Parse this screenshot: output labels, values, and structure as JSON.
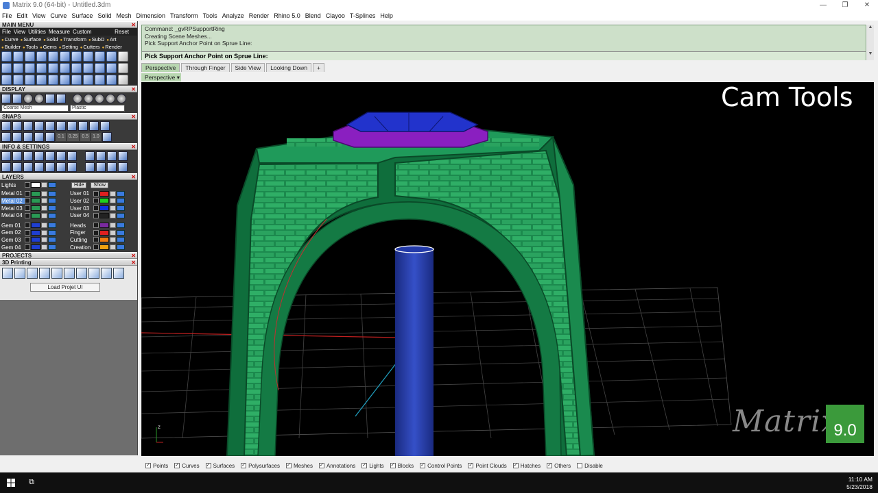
{
  "window": {
    "title": "Matrix 9.0 (64-bit) - Untitled.3dm",
    "controls": [
      "minimize-icon",
      "restore-icon",
      "close-icon"
    ]
  },
  "menubar": [
    "File",
    "Edit",
    "View",
    "Curve",
    "Surface",
    "Solid",
    "Mesh",
    "Dimension",
    "Transform",
    "Tools",
    "Analyze",
    "Render",
    "Rhino 5.0",
    "Blend",
    "Clayoo",
    "T-Splines",
    "Help"
  ],
  "leftpanel": {
    "main_menu": {
      "header": "MAIN MENU",
      "items": [
        "File",
        "View",
        "Utilities",
        "Measure",
        "Custom"
      ],
      "reset": "Reset",
      "categories_row1": [
        "Curve",
        "Surface",
        "Solid",
        "Transform",
        "SubD",
        "Art"
      ],
      "categories_row2": [
        "Builder",
        "Tools",
        "Gems",
        "Setting",
        "Cutters",
        "Render"
      ]
    },
    "display": {
      "header": "DISPLAY",
      "mesh_combo": "Coarse Mesh",
      "material_combo": "Plastic"
    },
    "snaps": {
      "header": "SNAPS",
      "values": [
        "0.1",
        "0.25",
        "0.5",
        "1.0"
      ]
    },
    "info": {
      "header": "INFO & SETTINGS"
    },
    "layers": {
      "header": "LAYERS",
      "lights_label": "Lights",
      "hide_label": "Hide",
      "show_label": "Show",
      "left": [
        {
          "name": "Metal 01",
          "color": "#2a9a55"
        },
        {
          "name": "Metal 02",
          "color": "#2a9a55",
          "selected": true
        },
        {
          "name": "Metal 03",
          "color": "#2a9a55"
        },
        {
          "name": "Metal 04",
          "color": "#2a9a55"
        },
        {
          "name": "Gem 01",
          "color": "#1f3fd0"
        },
        {
          "name": "Gem 02",
          "color": "#1f3fd0"
        },
        {
          "name": "Gem 03",
          "color": "#1f3fd0"
        },
        {
          "name": "Gem 04",
          "color": "#1f3fd0"
        }
      ],
      "right": [
        {
          "name": "User 01",
          "color": "#e02020"
        },
        {
          "name": "User 02",
          "color": "#20d020"
        },
        {
          "name": "User 03",
          "color": "#1030e0"
        },
        {
          "name": "User 04",
          "color": "#222222"
        },
        {
          "name": "Heads",
          "color": "#7a2aa0"
        },
        {
          "name": "Finger",
          "color": "#e02020"
        },
        {
          "name": "Cutting",
          "color": "#f07a10"
        },
        {
          "name": "Creation",
          "color": "#f0a010"
        }
      ]
    },
    "projects": {
      "header": "PROJECTS",
      "printing_header": "3D Printing",
      "load_button": "Load Projet UI"
    }
  },
  "command": {
    "lines": [
      "Command: _gvRPSupportRing",
      "Creating Scene Meshes...",
      "Pick Support Anchor Point on Sprue Line:"
    ],
    "prompt": "Pick Support Anchor Point on Sprue Line:"
  },
  "viewport": {
    "tabs": [
      "Perspective",
      "Through Finger",
      "Side View",
      "Looking Down"
    ],
    "active_tab": "Perspective",
    "label": "Perspective",
    "overlay_title": "Cam Tools",
    "logo_text": "Matrix",
    "logo_version": "9.0",
    "colors": {
      "metal": "#1f9a5a",
      "metal_dark": "#0d5a33",
      "gem_top": "#2233cc",
      "bezel": "#8a1fc0",
      "sprue": "#2a3faa"
    }
  },
  "filters": [
    {
      "label": "Points",
      "checked": true
    },
    {
      "label": "Curves",
      "checked": true
    },
    {
      "label": "Surfaces",
      "checked": true
    },
    {
      "label": "Polysurfaces",
      "checked": true
    },
    {
      "label": "Meshes",
      "checked": true
    },
    {
      "label": "Annotations",
      "checked": true
    },
    {
      "label": "Lights",
      "checked": true
    },
    {
      "label": "Blocks",
      "checked": true
    },
    {
      "label": "Control Points",
      "checked": true
    },
    {
      "label": "Point Clouds",
      "checked": true
    },
    {
      "label": "Hatches",
      "checked": true
    },
    {
      "label": "Others",
      "checked": true
    },
    {
      "label": "Disable",
      "checked": false
    }
  ],
  "taskbar": {
    "time": "11:10 AM",
    "date": "5/23/2018"
  }
}
